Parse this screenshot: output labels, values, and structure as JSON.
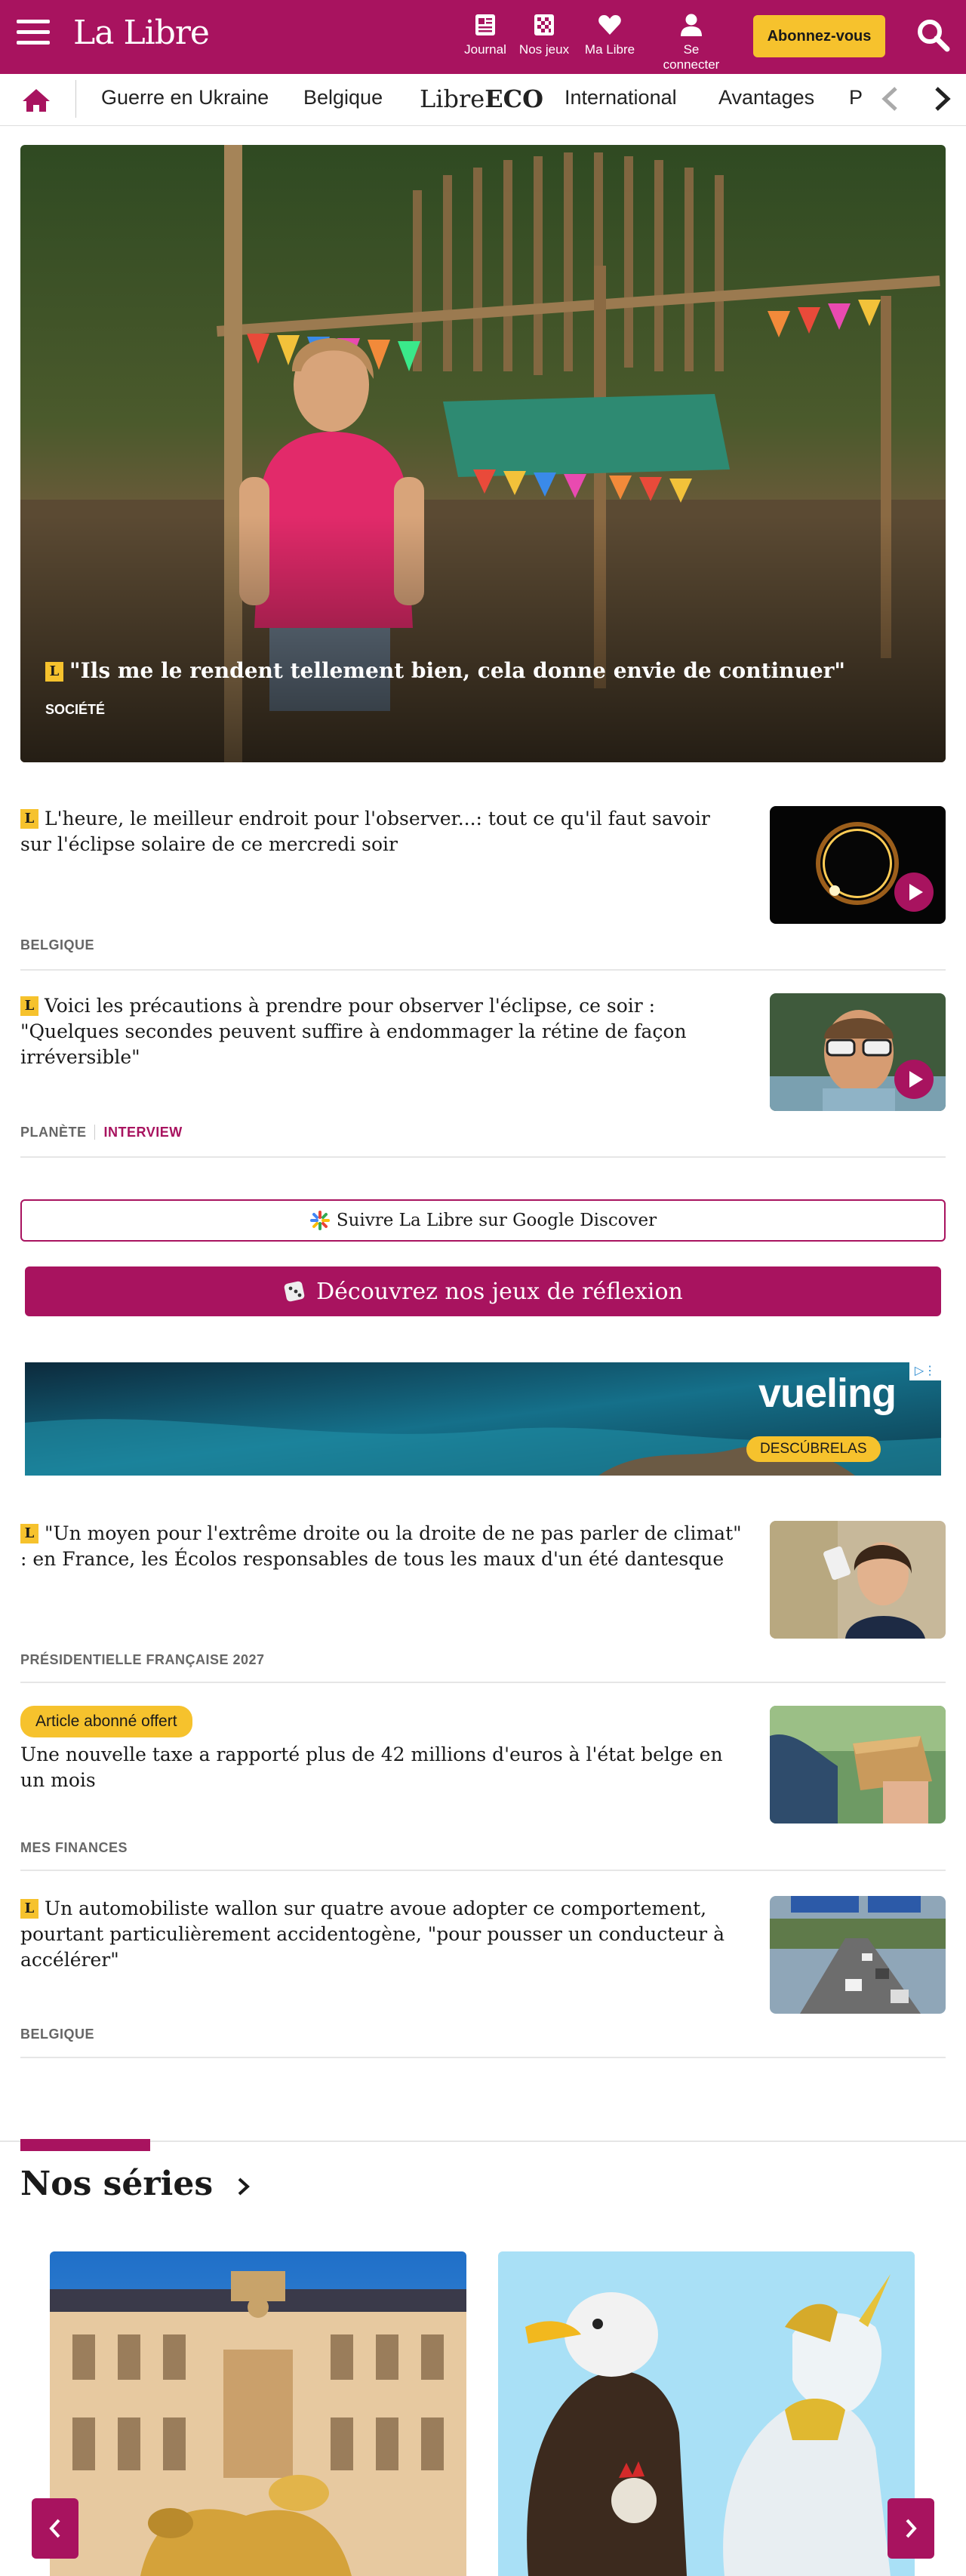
{
  "header": {
    "logo": "La Libre",
    "tools": [
      {
        "icon": "newspaper-icon",
        "label": "Journal"
      },
      {
        "icon": "games-icon",
        "label": "Nos jeux"
      },
      {
        "icon": "heart-icon",
        "label": "Ma Libre"
      },
      {
        "icon": "user-icon",
        "label": "Se connecter"
      }
    ],
    "subscribe_label": "Abonnez-vous",
    "accent": "#a8135f",
    "highlight": "#f6c22d"
  },
  "nav": {
    "items": [
      "Guerre en Ukraine",
      "Belgique",
      "International",
      "Avantages",
      "P"
    ],
    "eco_prefix": "Libre",
    "eco_suffix": "ECO"
  },
  "hero": {
    "badge": "L",
    "title": "\"Ils me le rendent tellement bien, cela donne envie de continuer\"",
    "tag": "SOCIÉTÉ"
  },
  "articles": [
    {
      "badge": "L",
      "title": "L'heure, le meilleur endroit pour l'observer...: tout ce qu'il faut savoir sur l'éclipse solaire de ce mercredi soir",
      "tags": [
        "BELGIQUE"
      ],
      "video": true
    },
    {
      "badge": "L",
      "title": "Voici les précautions à prendre pour observer l'éclipse, ce soir : \"Quelques secondes peuvent suffire à endommager la rétine de façon irréversible\"",
      "tags": [
        "PLANÈTE",
        "INTERVIEW"
      ],
      "video": true
    }
  ],
  "follow_label": "Suivre La Libre sur Google Discover",
  "games_label": "Découvrez nos jeux de réflexion",
  "ad": {
    "brand": "vueling",
    "cta": "DESCÚBRELAS"
  },
  "articles2": [
    {
      "badge": "L",
      "title": "\"Un moyen pour l'extrême droite ou la droite de ne pas parler de climat\" : en France, les Écolos responsables de tous les maux d'un été dantesque",
      "tags": [
        "PRÉSIDENTIELLE FRANÇAISE 2027"
      ]
    },
    {
      "pill": "Article abonné offert",
      "title": "Une nouvelle taxe a rapporté plus de 42 millions d'euros à l'état belge en un mois",
      "tags": [
        "MES FINANCES"
      ]
    },
    {
      "badge": "L",
      "title": "Un automobiliste wallon sur quatre avoue adopter ce comportement, pourtant particulièrement accidentogène, \"pour pousser un conducteur à accélérer\"",
      "tags": [
        "BELGIQUE"
      ]
    }
  ],
  "series": {
    "title": "Nos séries"
  }
}
